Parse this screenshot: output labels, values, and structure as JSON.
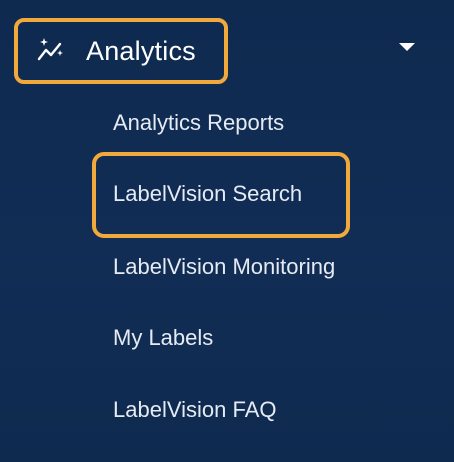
{
  "header": {
    "title": "Analytics",
    "icon": "sparkle-chart-icon",
    "expanded": true
  },
  "menu": {
    "items": [
      {
        "label": "Analytics Reports"
      },
      {
        "label": "LabelVision Search",
        "highlighted": true
      },
      {
        "label": "LabelVision Monitoring"
      },
      {
        "label": "My Labels"
      },
      {
        "label": "LabelVision FAQ"
      }
    ]
  },
  "colors": {
    "background": "#0f2a4f",
    "highlight": "#f2a93b",
    "text": "#e6ebf3"
  }
}
